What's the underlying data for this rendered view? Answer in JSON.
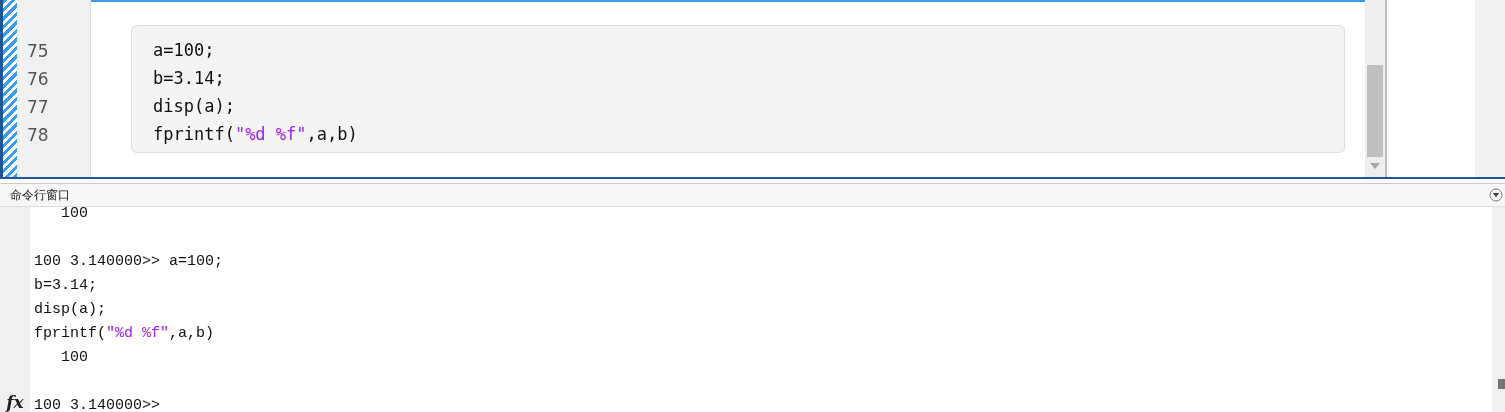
{
  "editor": {
    "lines": [
      {
        "number": "75",
        "parts": [
          {
            "text": "a=100;",
            "kind": "plain"
          }
        ]
      },
      {
        "number": "76",
        "parts": [
          {
            "text": "b=3.14;",
            "kind": "plain"
          }
        ]
      },
      {
        "number": "77",
        "parts": [
          {
            "text": "disp(a);",
            "kind": "plain"
          }
        ]
      },
      {
        "number": "78",
        "parts": [
          {
            "text": "fprintf(",
            "kind": "plain"
          },
          {
            "text": "\"%d %f\"",
            "kind": "string"
          },
          {
            "text": ",a,b)",
            "kind": "plain"
          }
        ]
      }
    ]
  },
  "command_window": {
    "title": "命令行窗口",
    "lines": [
      {
        "parts": [
          {
            "text": "   100",
            "kind": "plain"
          }
        ]
      },
      {
        "gap_before": true,
        "parts": [
          {
            "text": "100 3.140000>> a=100;",
            "kind": "plain"
          }
        ]
      },
      {
        "parts": [
          {
            "text": "b=3.14;",
            "kind": "plain"
          }
        ]
      },
      {
        "parts": [
          {
            "text": "disp(a);",
            "kind": "plain"
          }
        ]
      },
      {
        "parts": [
          {
            "text": "fprintf(",
            "kind": "plain"
          },
          {
            "text": "\"%d %f\"",
            "kind": "string"
          },
          {
            "text": ",a,b)",
            "kind": "plain"
          }
        ]
      },
      {
        "parts": [
          {
            "text": "   100",
            "kind": "plain"
          }
        ]
      },
      {
        "gap_before": true,
        "parts": [
          {
            "text": "100 3.140000>>",
            "kind": "plain"
          }
        ]
      }
    ],
    "function_button": "fx"
  }
}
